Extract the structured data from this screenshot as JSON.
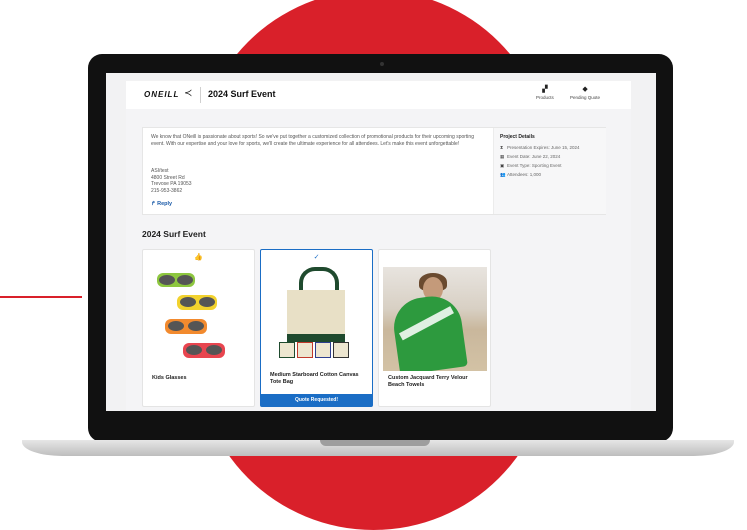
{
  "colors": {
    "brand_red": "#d9202a",
    "accent_blue": "#1a6dc5",
    "thumb_green": "#2e8b57"
  },
  "header": {
    "logo_text": "ONEILL",
    "title": "2024 Surf Event",
    "nav": [
      {
        "label": "Products",
        "icon": "products-icon"
      },
      {
        "label": "Pending Quote",
        "icon": "tag-icon"
      }
    ]
  },
  "intro": {
    "text": "We know that ONeill is passionate about sports! So we've put together a customized collection of promotional products for their upcoming sporting event. With our expertise and your love for sports, we'll create the ultimate experience for all attendees. Let's make this event unforgettable!",
    "address": [
      "ASI/test",
      "4800 Street Rd",
      "Trevose PA 19053",
      "215-953-3862"
    ],
    "reply_label": "Reply"
  },
  "project_details": {
    "title": "Project Details",
    "rows": [
      {
        "icon": "hourglass-icon",
        "text": "Presentation Expires: June 15, 2024"
      },
      {
        "icon": "calendar-icon",
        "text": "Event Date: June 22, 2024"
      },
      {
        "icon": "event-type-icon",
        "text": "Event Type: Sporting Event"
      },
      {
        "icon": "people-icon",
        "text": "Attendees: 1,000"
      }
    ]
  },
  "section_title": "2024 Surf Event",
  "products": [
    {
      "name": "Kids Glasses",
      "badge": "👍",
      "selected": false
    },
    {
      "name": "Medium Starboard Cotton Canvas Tote Bag",
      "badge": "✓",
      "selected": true,
      "status": "Quote Requested!"
    },
    {
      "name": "Custom Jacquard Terry Velour Beach Towels",
      "badge": "",
      "selected": false
    }
  ]
}
